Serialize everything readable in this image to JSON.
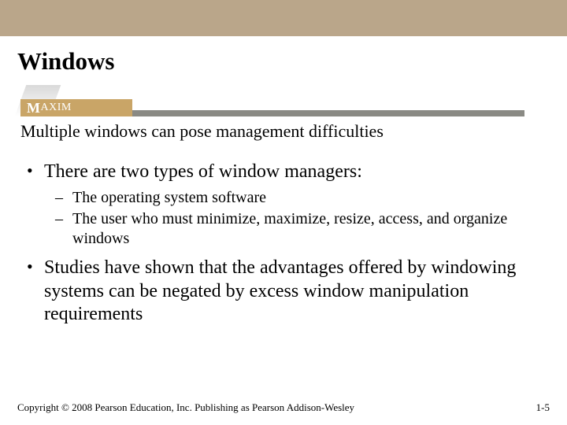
{
  "title": "Windows",
  "maxim_label_big": "M",
  "maxim_label_rest": "AXIM",
  "subtitle": "Multiple windows can pose management difficulties",
  "bullets": [
    {
      "text": "There are two types of window managers:",
      "sub": [
        "The operating system software",
        "The user who must minimize, maximize, resize, access, and organize windows"
      ]
    },
    {
      "text": " Studies have shown that the advantages offered by windowing systems can be negated by excess window manipulation requirements",
      "sub": []
    }
  ],
  "footer": {
    "copyright": "Copyright © 2008 Pearson Education, Inc. Publishing as Pearson Addison-Wesley",
    "page": "1-5"
  }
}
